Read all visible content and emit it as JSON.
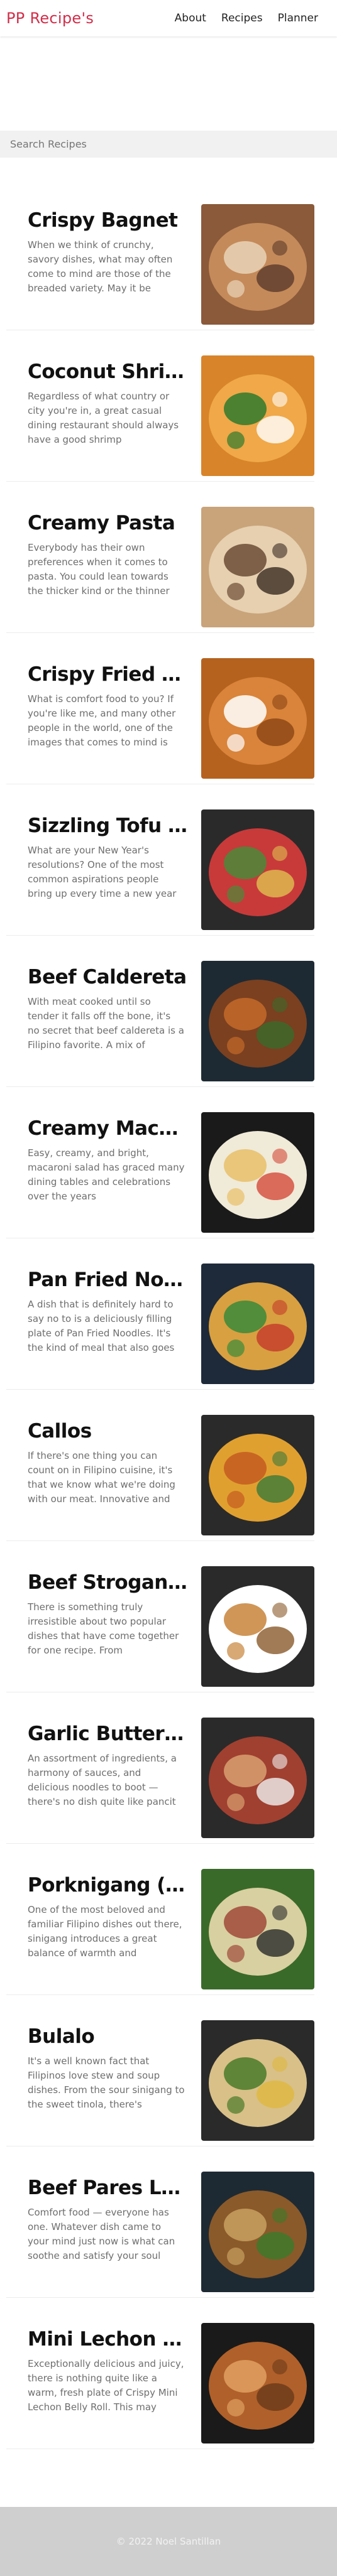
{
  "header": {
    "brand": "PP Recipe's",
    "nav": [
      "About",
      "Recipes",
      "Planner"
    ]
  },
  "search": {
    "placeholder": "Search Recipes"
  },
  "recipes": [
    {
      "title": "Crispy Bagnet",
      "desc": "When we think of crunchy, savory dishes, what may often come to mind are those of the breaded variety. May it be",
      "colors": [
        "#8a5a3a",
        "#c58a5a",
        "#e8d4b8",
        "#5a3a2a"
      ]
    },
    {
      "title": "Coconut Shrimp",
      "desc": "Regardless of what country or city you're in, a great casual dining restaurant should always have a good shrimp",
      "colors": [
        "#d8842a",
        "#f0a848",
        "#2e7a2e",
        "#ffffff"
      ]
    },
    {
      "title": "Creamy Pasta",
      "desc": "Everybody has their own preferences when it comes to pasta. You could lean towards the thicker kind or the thinner",
      "colors": [
        "#c9a47a",
        "#e6d0b0",
        "#6b4b35",
        "#3a2a22"
      ]
    },
    {
      "title": "Crispy Fried Chicken",
      "desc": "What is comfort food to you? If you're like me, and many other people in the world, one of the images that comes to mind is",
      "colors": [
        "#b5621f",
        "#d9843a",
        "#ffffff",
        "#8a4514"
      ]
    },
    {
      "title": "Sizzling Tofu Stir Fry",
      "desc": "What are your New Year's resolutions? One of the most common aspirations people bring up every time a new year",
      "colors": [
        "#2a2a2a",
        "#c83a3a",
        "#4a8a3a",
        "#e0c050"
      ]
    },
    {
      "title": "Beef Caldereta",
      "desc": "With meat cooked until so tender it falls off the bone, it's no secret that beef caldereta is a Filipino favorite. A mix of",
      "colors": [
        "#1e2a33",
        "#7a4020",
        "#c46a2a",
        "#3a6a2a"
      ]
    },
    {
      "title": "Creamy Macaroni Salad",
      "desc": "Easy, creamy, and bright, macaroni salad has graced many dining tables and celebrations over the years",
      "colors": [
        "#1a1a1a",
        "#f0ead8",
        "#e8c068",
        "#d44a3a"
      ]
    },
    {
      "title": "Pan Fried Noodles",
      "desc": "A dish that is definitely hard to say no to is a deliciously filling plate of Pan Fried Noodles. It's the kind of meal that also goes",
      "colors": [
        "#1e2a3a",
        "#d8a040",
        "#3a8a3a",
        "#c43a2a"
      ]
    },
    {
      "title": "Callos",
      "desc": "If there's one thing you can count on in Filipino cuisine, it's that we know what we're doing with our meat. Innovative and",
      "colors": [
        "#2a2a2a",
        "#e0a030",
        "#c45a20",
        "#3a7a3a"
      ]
    },
    {
      "title": "Beef Stroganoff Pot Pie",
      "desc": "There is something truly irresistible about two popular dishes that have come together for one recipe. From",
      "colors": [
        "#2a2a2a",
        "#ffffff",
        "#c8843a",
        "#8a5a2a"
      ]
    },
    {
      "title": "Garlic Butter Steak",
      "desc": "An assortment of ingredients, a harmony of sauces, and delicious noodles to boot — there's no dish quite like pancit",
      "colors": [
        "#2a2a2a",
        "#a04030",
        "#d8a070",
        "#f0f0f0"
      ]
    },
    {
      "title": "Porknigang (Sinigang)",
      "desc": "One of the most beloved and familiar Filipino dishes out there, sinigang introduces a great balance of warmth and",
      "colors": [
        "#3a6a2a",
        "#d8d0a0",
        "#a04a3a",
        "#2a2a2a"
      ]
    },
    {
      "title": "Bulalo",
      "desc": "It's a well known fact that Filipinos love stew and soup dishes. From the sour sinigang to the sweet tinola, there's",
      "colors": [
        "#2a2a2a",
        "#d8c088",
        "#4a7a2a",
        "#e0b840"
      ]
    },
    {
      "title": "Beef Pares Lomi",
      "desc": "Comfort food — everyone has one. Whatever dish came to your mind just now is what can soothe and satisfy your soul",
      "colors": [
        "#1e2a33",
        "#8a5a2a",
        "#c8a060",
        "#3a7a2a"
      ]
    },
    {
      "title": "Mini Lechon Belly Roll",
      "desc": "Exceptionally delicious and juicy, there is nothing quite like a warm, fresh plate of Crispy Mini Lechon Belly Roll. This may",
      "colors": [
        "#1a1a1a",
        "#b0602a",
        "#e0a060",
        "#6a3a1a"
      ]
    }
  ],
  "footer": {
    "text": "© 2022 Noel Santillan"
  }
}
